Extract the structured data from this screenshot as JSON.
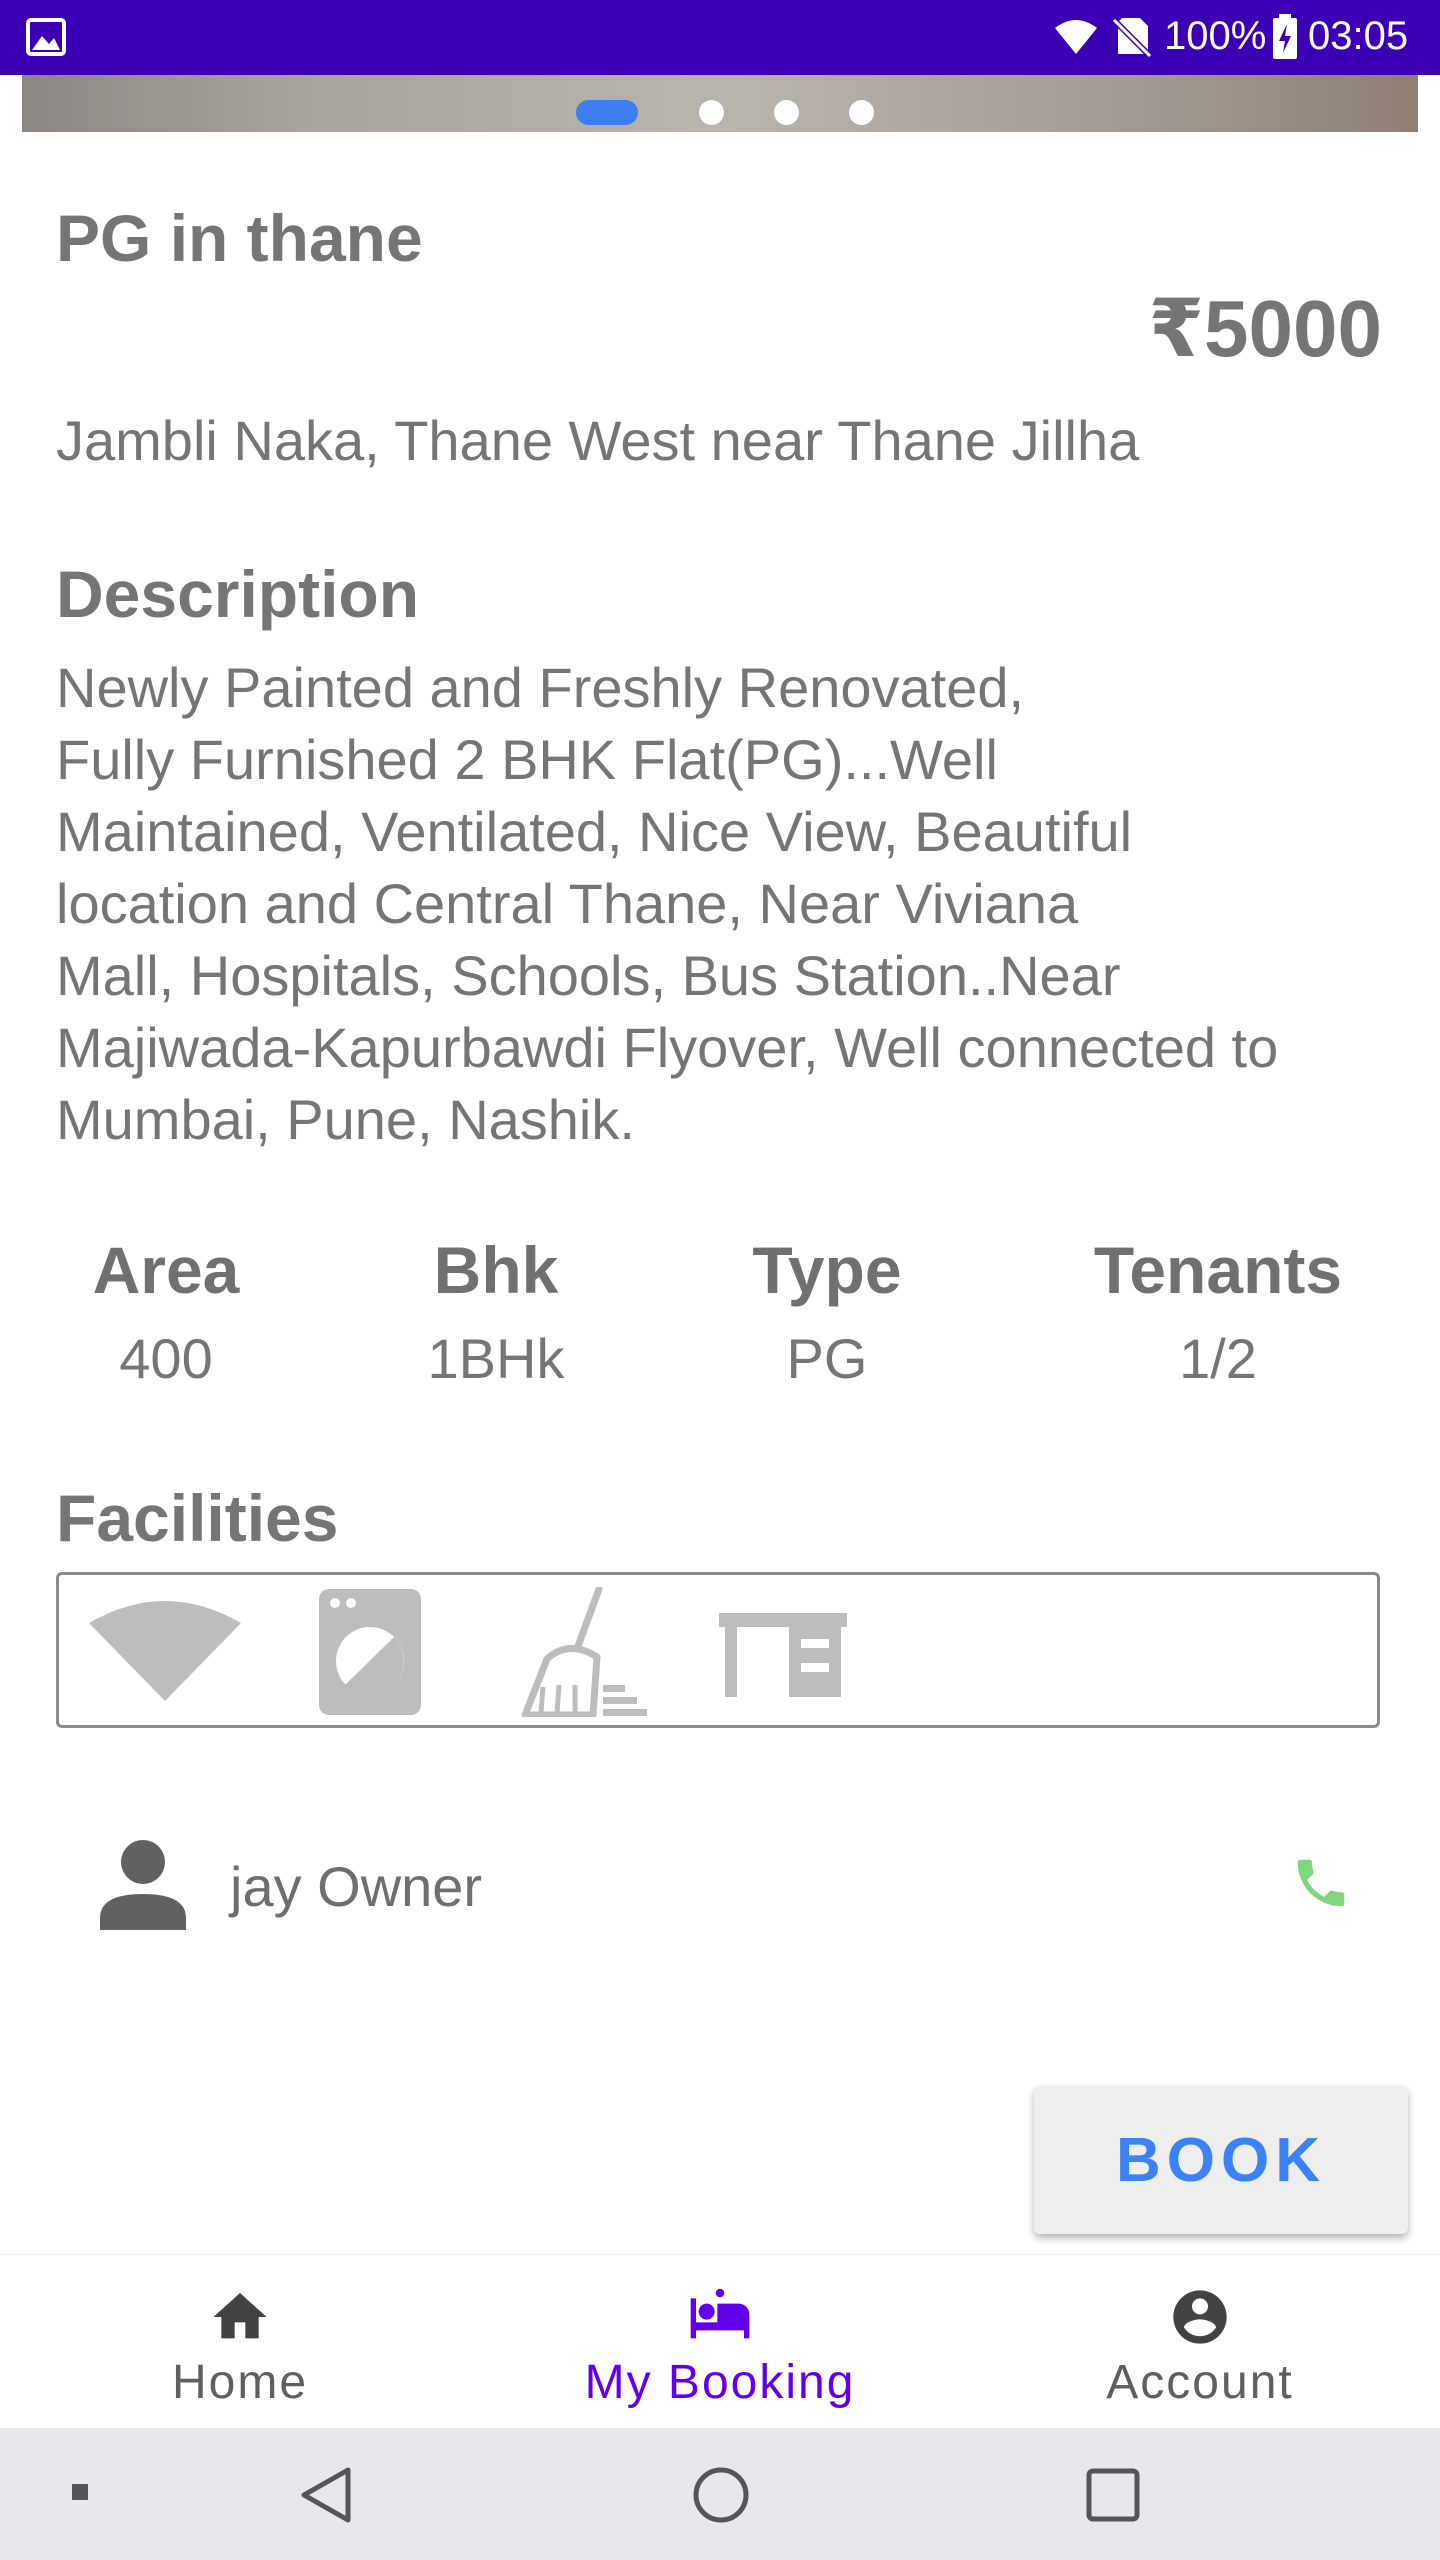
{
  "status_bar": {
    "battery": "100%",
    "time": "03:05",
    "icons": [
      "image-icon",
      "wifi-icon",
      "no-sim-icon",
      "battery-charging-icon"
    ]
  },
  "carousel": {
    "slide_count": 4,
    "active_index": 0
  },
  "listing": {
    "title": "PG in thane",
    "price": "₹5000",
    "address": "Jambli Naka, Thane West near Thane Jillha"
  },
  "description": {
    "heading": "Description",
    "body": "Newly Painted and Freshly Renovated,\nFully Furnished 2 BHK Flat(PG)...Well\nMaintained, Ventilated, Nice View, Beautiful\nlocation and Central Thane, Near Viviana\nMall, Hospitals, Schools, Bus Station..Near\nMajiwada-Kapurbawdi Flyover, Well connected to\nMumbai, Pune, Nashik."
  },
  "stats": [
    {
      "label": "Area",
      "value": "400"
    },
    {
      "label": "Bhk",
      "value": "1BHk"
    },
    {
      "label": "Type",
      "value": "PG"
    },
    {
      "label": "Tenants",
      "value": "1/2"
    }
  ],
  "facilities": {
    "heading": "Facilities",
    "icons": [
      "wifi-icon",
      "washing-machine-icon",
      "cleaning-broom-icon",
      "desk-icon"
    ]
  },
  "owner": {
    "name": "jay Owner",
    "icons": [
      "person-icon",
      "phone-icon"
    ]
  },
  "book_button": {
    "label": "BOOK"
  },
  "bottom_nav": {
    "items": [
      {
        "label": "Home",
        "icon": "home-icon"
      },
      {
        "label": "My Booking",
        "icon": "hotel-bed-icon",
        "active": true
      },
      {
        "label": "Account",
        "icon": "account-circle-icon"
      }
    ]
  },
  "system_nav": {
    "icons": [
      "back-icon",
      "home-circle-icon",
      "recents-icon"
    ]
  },
  "colors": {
    "status_bar": "#3b00b3",
    "accent_blue": "#3d7ef0",
    "nav_active": "#6200ee",
    "phone_green": "#7ed67e",
    "text_grey": "#757575"
  }
}
